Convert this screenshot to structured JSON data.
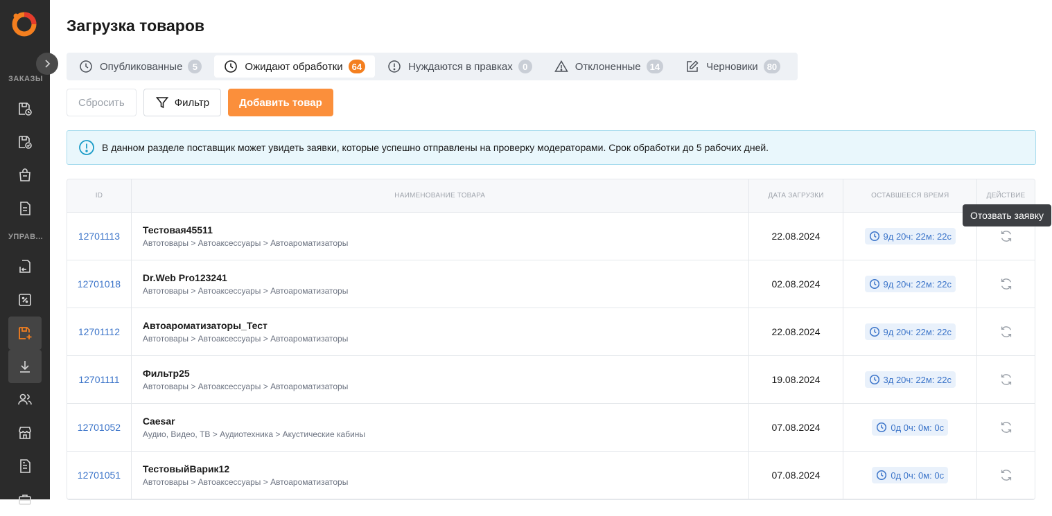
{
  "sidebar": {
    "sections": [
      {
        "label": "ЗАКАЗЫ"
      },
      {
        "label": "УПРАВ..."
      }
    ],
    "items": [
      {
        "icon": "orders-clock-icon"
      },
      {
        "icon": "orders-check-icon"
      },
      {
        "icon": "bag-icon"
      },
      {
        "icon": "document-icon"
      },
      {
        "icon": "returns-icon"
      },
      {
        "icon": "percent-icon"
      },
      {
        "icon": "add-product-icon"
      },
      {
        "icon": "download-icon"
      },
      {
        "icon": "users-icon"
      },
      {
        "icon": "store-icon"
      },
      {
        "icon": "report-icon"
      },
      {
        "icon": "briefcase-icon"
      }
    ],
    "accent_color": "#f47f1f"
  },
  "page": {
    "title": "Загрузка товаров"
  },
  "tabs": [
    {
      "label": "Опубликованные",
      "count": "5",
      "icon": "clock-icon"
    },
    {
      "label": "Ожидают обработки",
      "count": "64",
      "icon": "clock-icon",
      "active": true
    },
    {
      "label": "Нуждаются в правках",
      "count": "0",
      "icon": "info-circle-icon"
    },
    {
      "label": "Отклоненные",
      "count": "14",
      "icon": "warning-icon"
    },
    {
      "label": "Черновики",
      "count": "80",
      "icon": "edit-icon"
    }
  ],
  "actions": {
    "reset": "Сбросить",
    "filter": "Фильтр",
    "add": "Добавить товар"
  },
  "info": {
    "text": "В данном разделе поставщик может увидеть заявки, которые успешно отправлены на проверку модераторами. Срок обработки до 5 рабочих дней."
  },
  "table": {
    "headers": {
      "id": "ID",
      "name": "НАИМЕНОВАНИЕ ТОВАРА",
      "date": "ДАТА ЗАГРУЗКИ",
      "remaining": "ОСТАВШЕЕСЯ ВРЕМЯ",
      "action": "ДЕЙСТВИЕ"
    },
    "rows": [
      {
        "id": "12701113",
        "name": "Тестовая45511",
        "category": "Автотовары > Автоаксессуары > Автоароматизаторы",
        "date": "22.08.2024",
        "remaining": "9д 20ч: 22м: 22с"
      },
      {
        "id": "12701018",
        "name": "Dr.Web Pro123241",
        "category": "Автотовары > Автоаксессуары > Автоароматизаторы",
        "date": "02.08.2024",
        "remaining": "9д 20ч: 22м: 22с"
      },
      {
        "id": "12701112",
        "name": "Автоароматизаторы_Тест",
        "category": "Автотовары > Автоаксессуары > Автоароматизаторы",
        "date": "22.08.2024",
        "remaining": "9д 20ч: 22м: 22с"
      },
      {
        "id": "12701111",
        "name": "Фильтр25",
        "category": "Автотовары > Автоаксессуары > Автоароматизаторы",
        "date": "19.08.2024",
        "remaining": "3д 20ч: 22м: 22с"
      },
      {
        "id": "12701052",
        "name": "Caesar",
        "category": "Аудио, Видео, ТВ > Аудиотехника > Акустические кабины",
        "date": "07.08.2024",
        "remaining": "0д 0ч: 0м: 0с"
      },
      {
        "id": "12701051",
        "name": "ТестовыйВарик12",
        "category": "Автотовары > Автоаксессуары > Автоароматизаторы",
        "date": "07.08.2024",
        "remaining": "0д 0ч: 0м: 0с"
      }
    ]
  },
  "tooltip": {
    "text": "Отозвать заявку"
  }
}
